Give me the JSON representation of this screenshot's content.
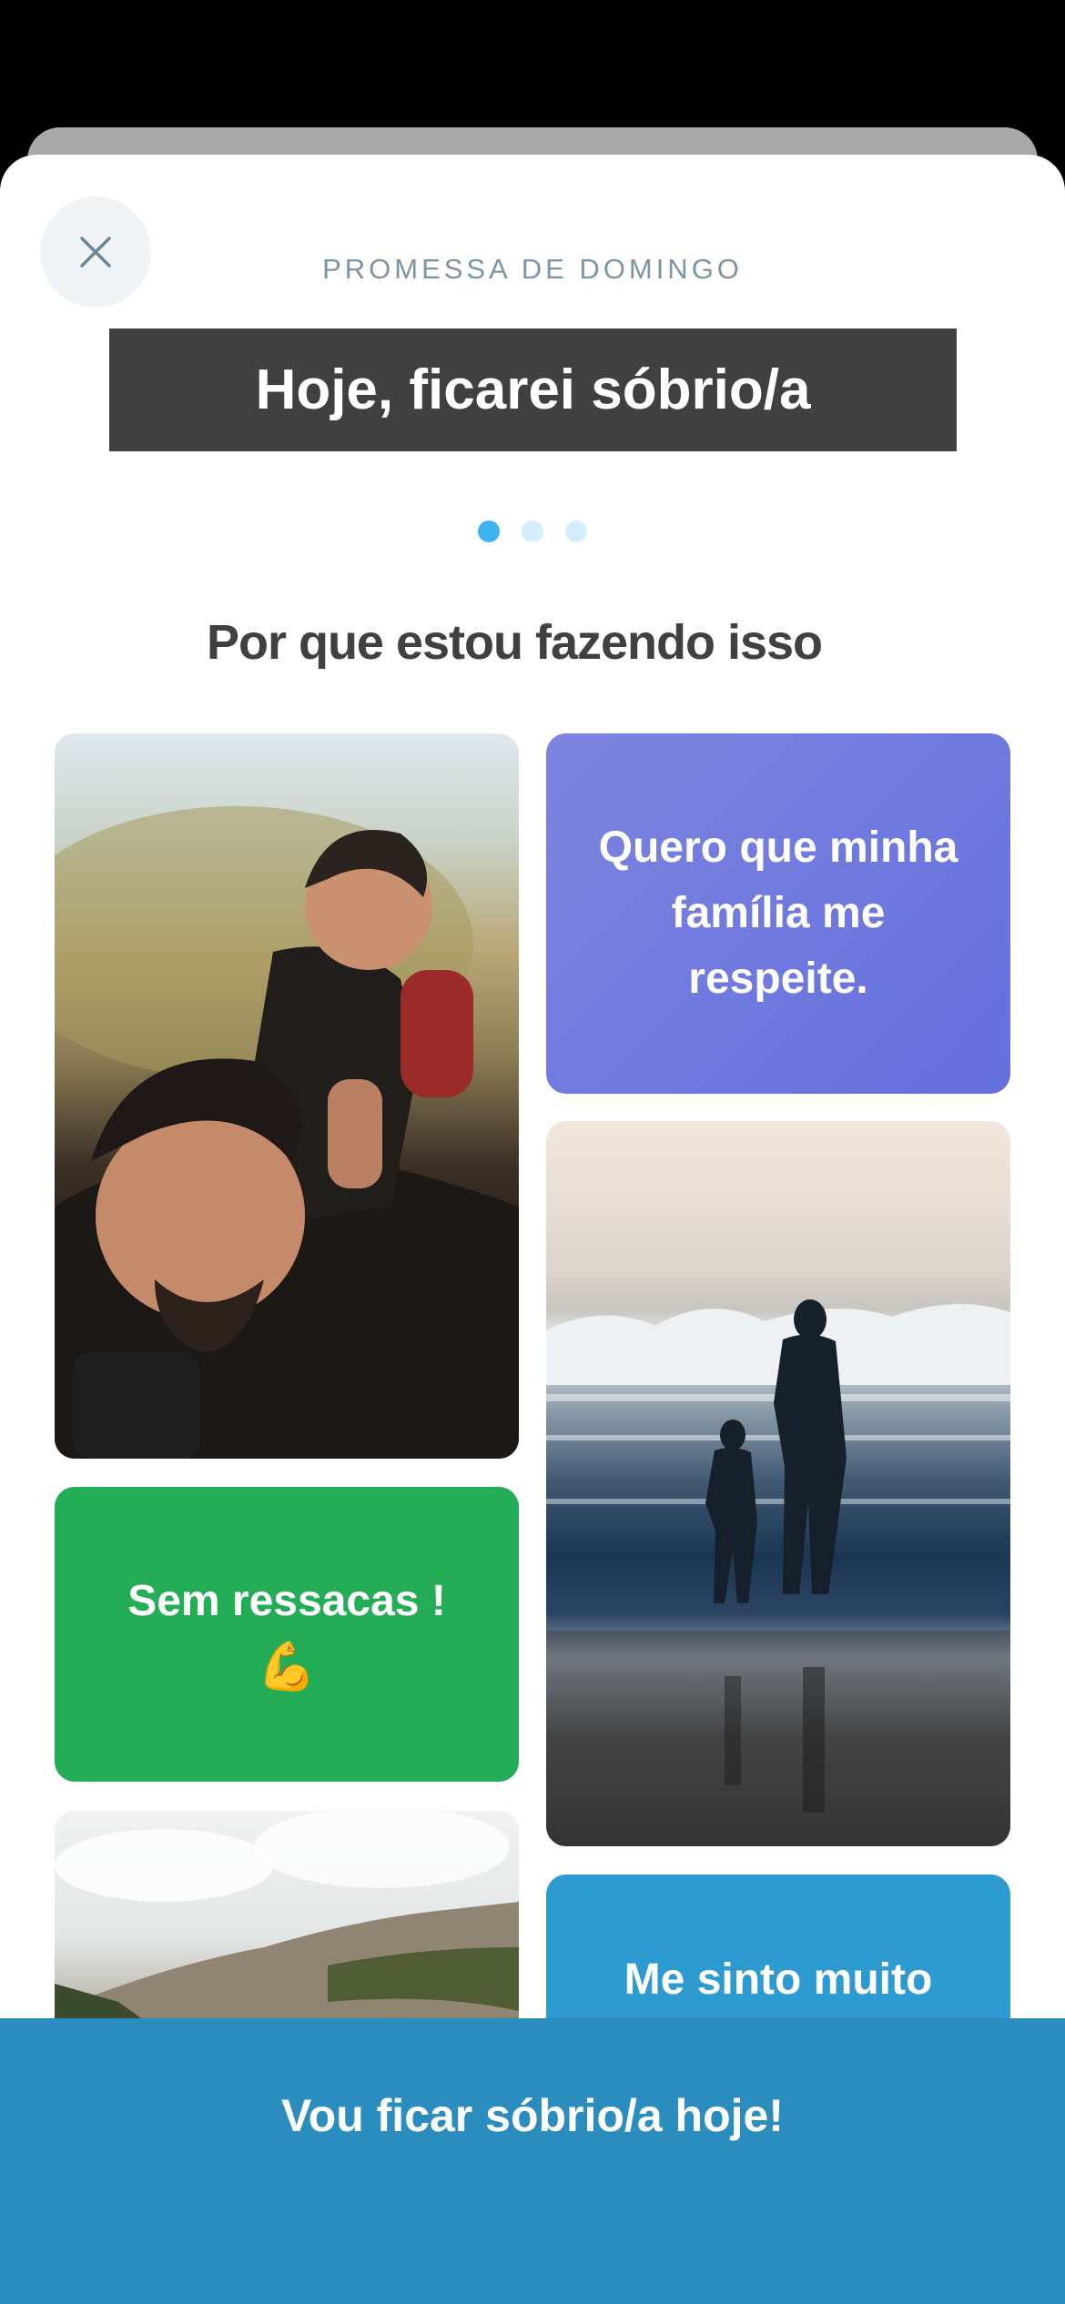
{
  "header": {
    "kicker": "PROMESSA DE DOMINGO",
    "promise": "Hoje, ficarei sóbrio/a",
    "close_icon": "close-icon"
  },
  "pager": {
    "count": 3,
    "active_index": 0
  },
  "section_title": "Por que estou fazendo isso",
  "cards": {
    "respect": "Quero que minha família me respeite.",
    "hangover": "Sem ressacas !",
    "hangover_emoji": "💪",
    "feel": "Me sinto muito"
  },
  "cta_label": "Vou ficar sóbrio/a hoje!",
  "colors": {
    "promise_banner": "#404040",
    "respect_card": "#6d78dd",
    "hangover_card": "#25ac57",
    "feel_card": "#2e9bd0",
    "cta": "#2b8cbe",
    "active_dot": "#3db2ef"
  }
}
